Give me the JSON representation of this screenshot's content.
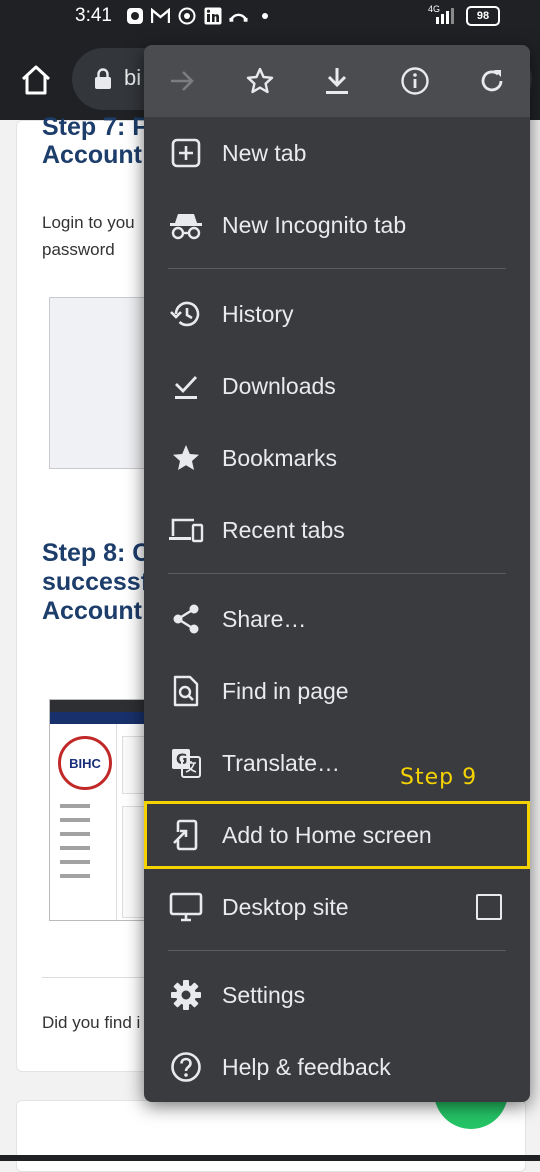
{
  "status_bar": {
    "time": "3:41",
    "network": "4G",
    "battery": "98",
    "icons": [
      "notification-app-icon",
      "gmail-icon",
      "chrome-icon",
      "linkedin-icon",
      "missed-call-icon",
      "dot-icon"
    ]
  },
  "browser": {
    "url_text": "bi"
  },
  "article": {
    "step7_heading_line1": "Step 7: F",
    "step7_heading_line2": "Account",
    "step7_text_line1": "Login to you",
    "step7_text_line2": "password",
    "step8_heading_line1": "Step 8:  C",
    "step8_heading_line2": "successf",
    "step8_heading_line3": "Account",
    "did_you_find": "Did you find i",
    "screenshot_logo": "BIHC"
  },
  "menu": {
    "toolbar_icons": [
      "forward-icon",
      "bookmark-star-icon",
      "download-icon",
      "info-icon",
      "reload-icon"
    ],
    "items": [
      {
        "label": "New tab",
        "icon": "new-tab-icon"
      },
      {
        "label": "New Incognito tab",
        "icon": "incognito-icon"
      },
      {
        "label": "History",
        "icon": "history-icon"
      },
      {
        "label": "Downloads",
        "icon": "downloads-icon"
      },
      {
        "label": "Bookmarks",
        "icon": "bookmarks-icon"
      },
      {
        "label": "Recent tabs",
        "icon": "recent-tabs-icon"
      },
      {
        "label": "Share…",
        "icon": "share-icon"
      },
      {
        "label": "Find in page",
        "icon": "find-in-page-icon"
      },
      {
        "label": "Translate…",
        "icon": "translate-icon"
      },
      {
        "label": "Add to Home screen",
        "icon": "add-to-home-icon"
      },
      {
        "label": "Desktop site",
        "icon": "desktop-icon",
        "checked": false
      },
      {
        "label": "Settings",
        "icon": "settings-icon"
      },
      {
        "label": "Help & feedback",
        "icon": "help-icon"
      }
    ]
  },
  "annotation": {
    "step_label": "Step 9",
    "highlight_color": "#f5d300"
  }
}
